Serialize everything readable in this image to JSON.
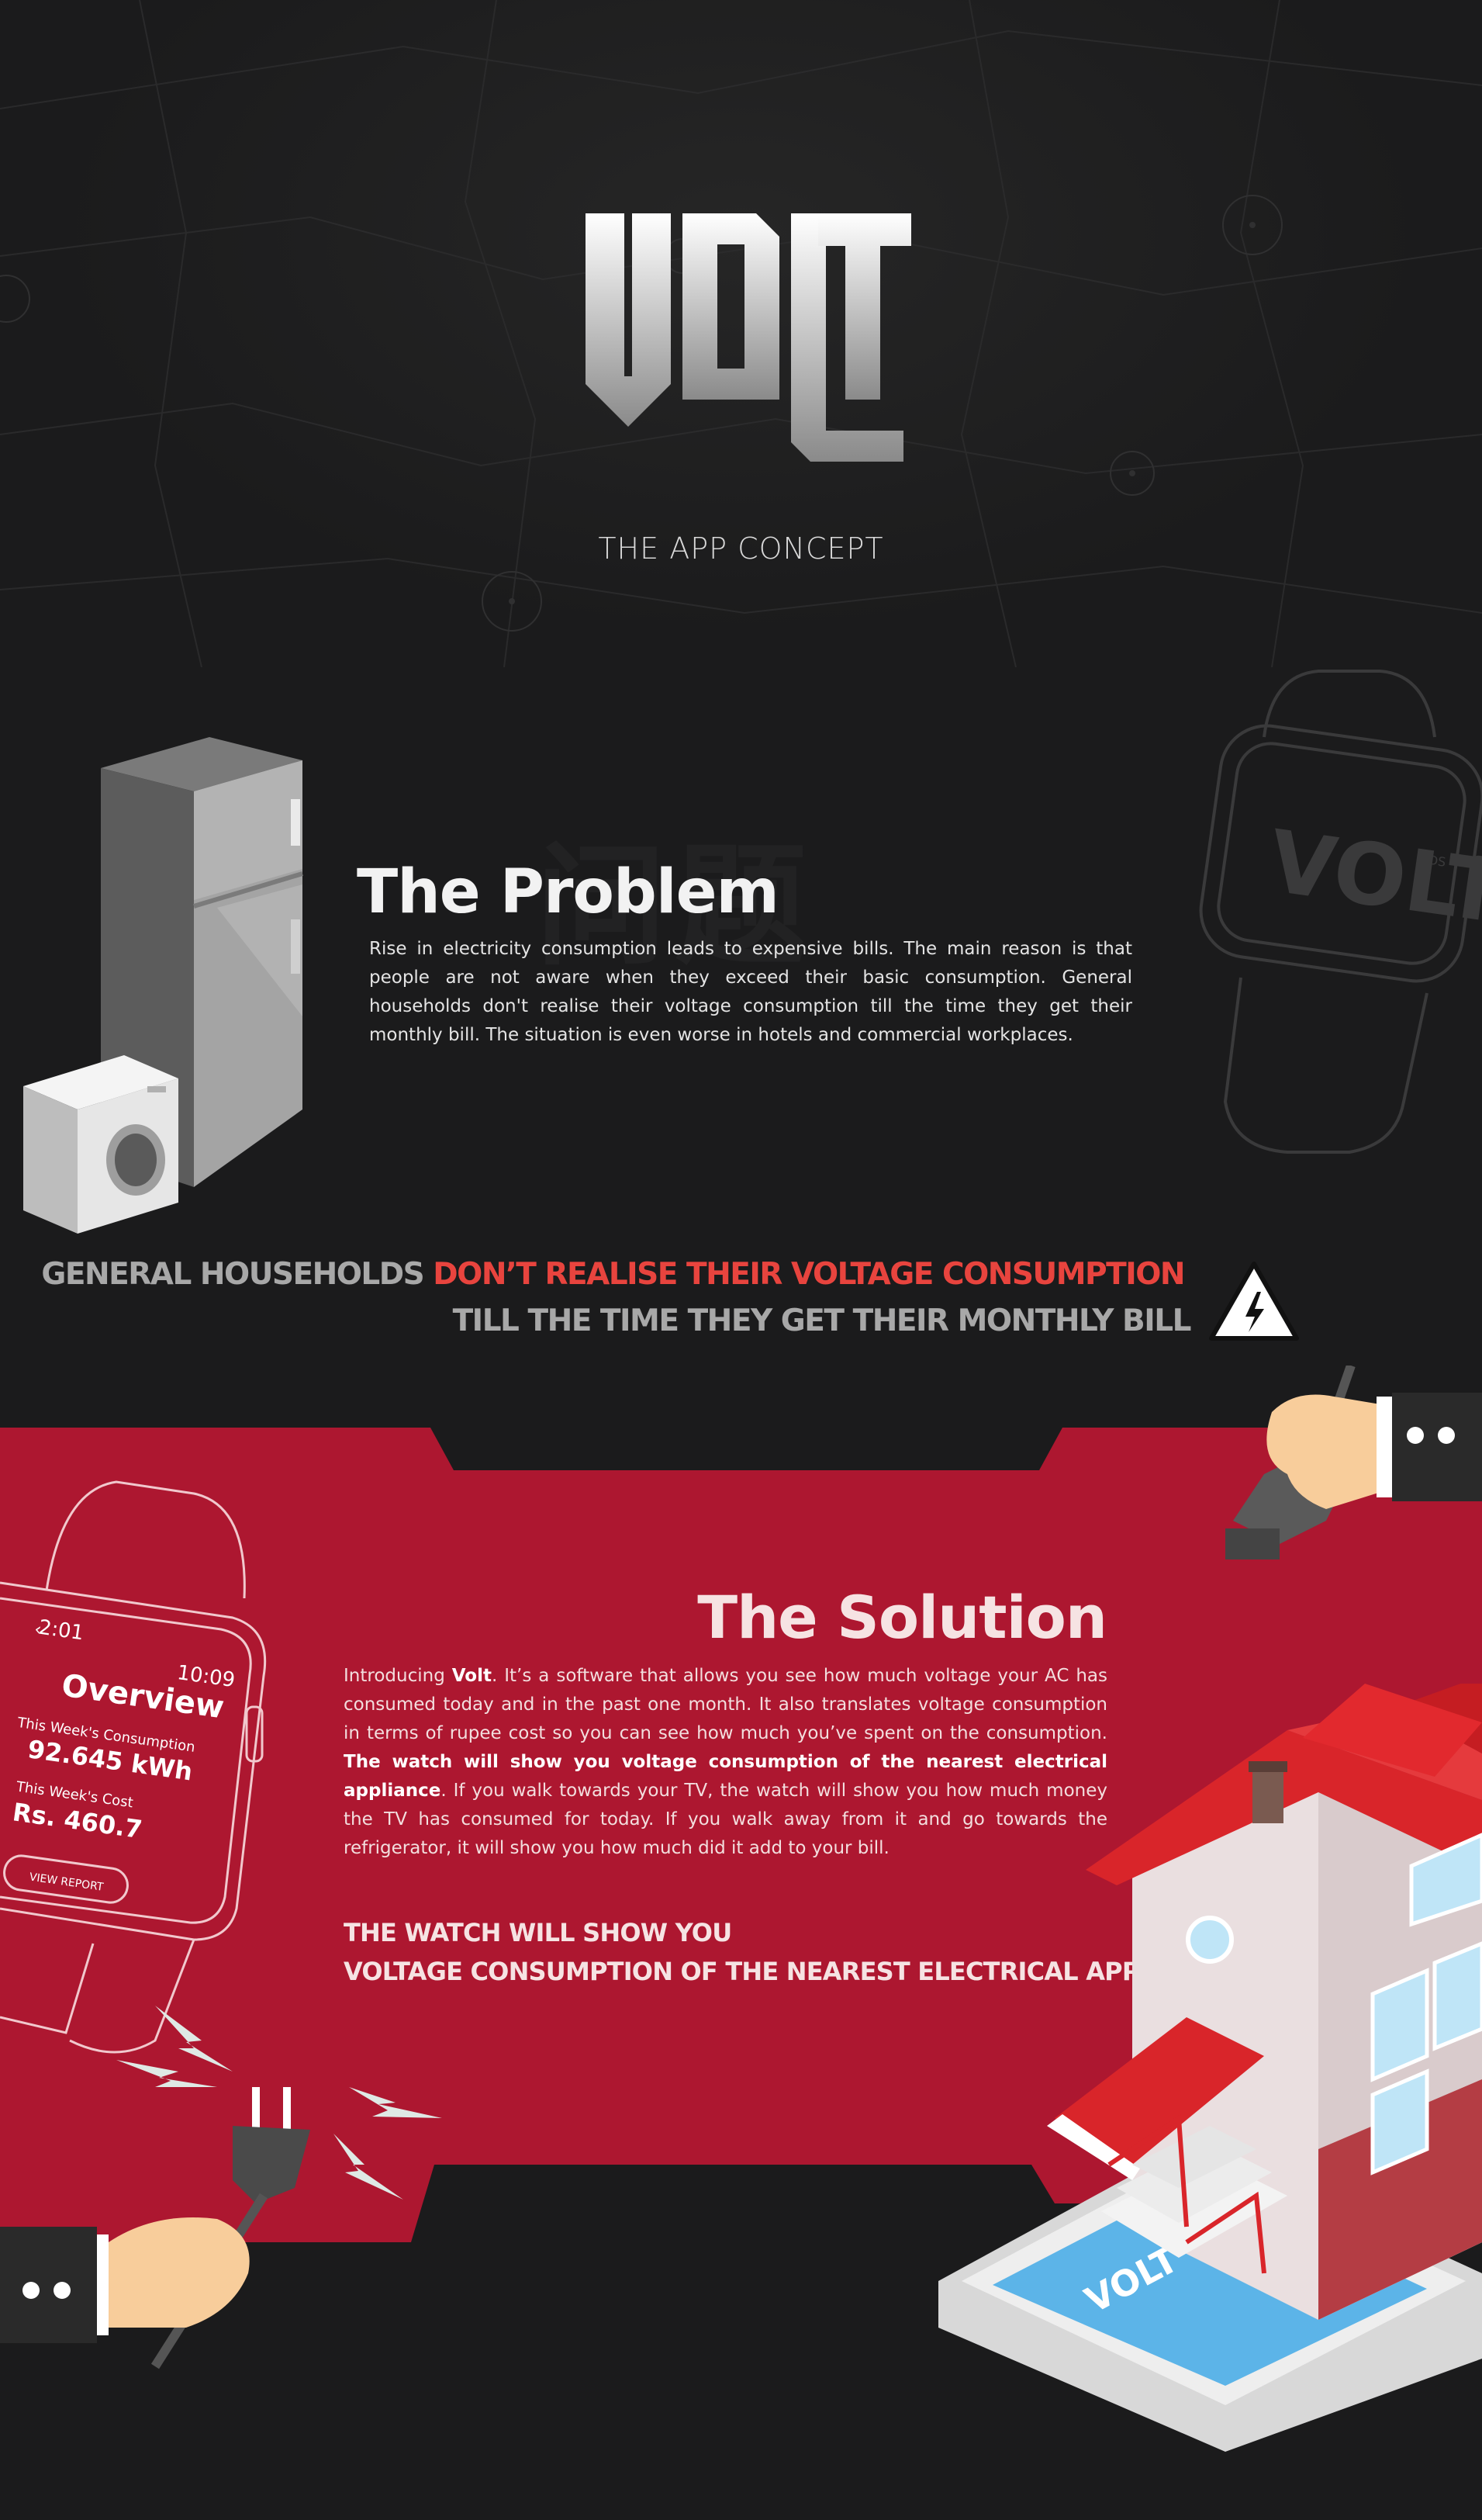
{
  "hero": {
    "logo_text": "VOLT",
    "tagline": "THE APP CONCEPT"
  },
  "problem": {
    "watermark": "问题",
    "title": "The Problem",
    "body": "Rise in electricity consumption leads to expensive bills. The main reason is that people are not aware when they exceed their basic consumption. General households don't realise their voltage consumption till the time they get their monthly bill. The situation is even worse in hotels and commercial workplaces.",
    "watch_logo": "VOLT",
    "watch_sup": "DS"
  },
  "callout": {
    "line1_part1": "GENERAL HOUSEHOLDS ",
    "line1_highlight": "DON’T REALISE THEIR VOLTAGE CONSUMPTION",
    "line2": "TILL THE TIME THEY GET THEIR MONTHLY BILL"
  },
  "solution": {
    "title": "The Solution",
    "body_intro": "Introducing ",
    "body_brand": "Volt",
    "body_part2": ". It’s a software that allows you see how much voltage your AC has consumed today and in the past one month. It also translates voltage consumption in terms of rupee cost so you can see how much you’ve spent on the consumption. ",
    "body_bold": "The watch will show you voltage consumption of the nearest electrical appliance",
    "body_part3": ". If you walk towards your TV, the watch will show you how much money the TV has consumed for today. If you walk away from it and go towards the refrigerator, it will show you how much did it add to your bill.",
    "headline_line1": "THE WATCH WILL SHOW YOU",
    "headline_line2": "VOLTAGE CONSUMPTION OF THE NEAREST ELECTRICAL APPLIANCE"
  },
  "watch_ui": {
    "back_time": "2:01",
    "clock": "10:09",
    "heading": "Overview",
    "consumption_label": "This Week's Consumption",
    "consumption_value": "92.645 kWh",
    "cost_label": "This Week's Cost",
    "cost_value": "Rs. 460.7",
    "button": "VIEW REPORT"
  },
  "house": {
    "logo": "VOLT"
  },
  "colors": {
    "background": "#1b1b1c",
    "brand_red": "#ad1730",
    "highlight_red": "#e8443e",
    "grey_text": "#a8a8a8"
  }
}
